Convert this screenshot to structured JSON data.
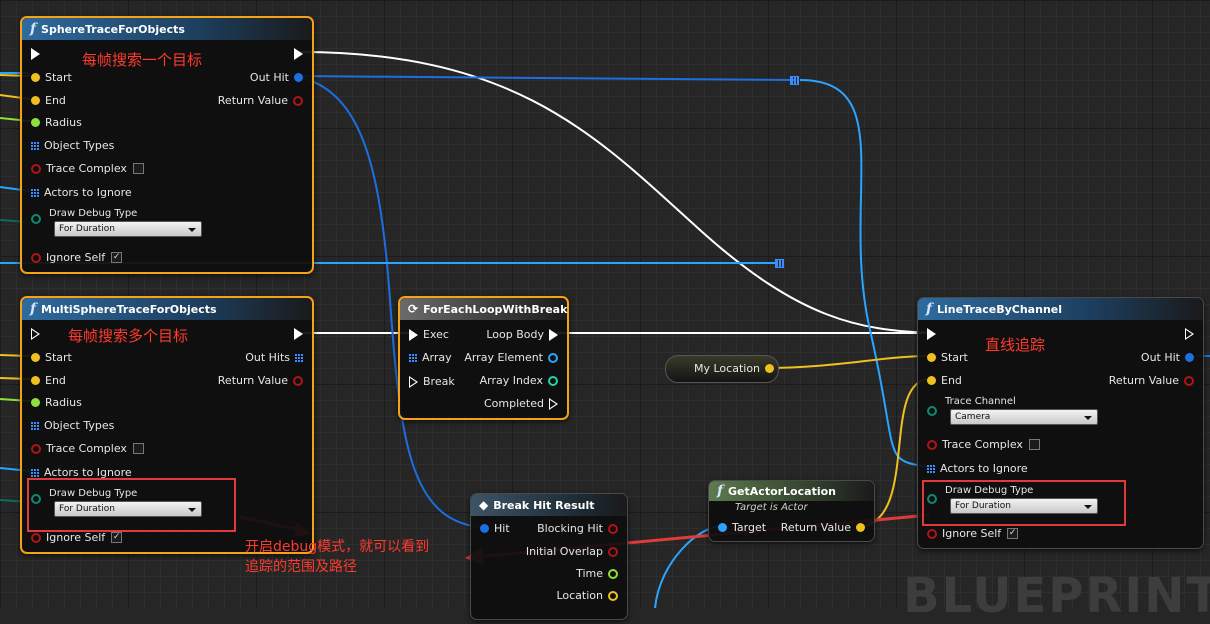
{
  "watermark": "BLUEPRINT",
  "colors": {
    "vector": "#f0c020",
    "float": "#8ce23a",
    "struct": "#1c6fe0",
    "bool": "#9a1010",
    "object": "#2aa4ff",
    "enum": "#0e6b58",
    "int": "#1ed6a3",
    "exec": "#ffffff",
    "selection": "#f5a217",
    "annotation": "#ff3a2e"
  },
  "nodes": {
    "sphere": {
      "title": "SphereTraceForObjects",
      "pins_in": {
        "start": "Start",
        "end": "End",
        "radius": "Radius",
        "object_types": "Object Types",
        "trace_complex": "Trace Complex",
        "actors_to_ignore": "Actors to Ignore",
        "draw_debug_type": "Draw Debug Type",
        "ignore_self": "Ignore Self"
      },
      "pins_out": {
        "out_hit": "Out Hit",
        "return_value": "Return Value"
      },
      "draw_debug_value": "For Duration"
    },
    "multisphere": {
      "title": "MultiSphereTraceForObjects",
      "pins_in": {
        "start": "Start",
        "end": "End",
        "radius": "Radius",
        "object_types": "Object Types",
        "trace_complex": "Trace Complex",
        "actors_to_ignore": "Actors to Ignore",
        "draw_debug_type": "Draw Debug Type",
        "ignore_self": "Ignore Self"
      },
      "pins_out": {
        "out_hits": "Out Hits",
        "return_value": "Return Value"
      },
      "draw_debug_value": "For Duration"
    },
    "foreach": {
      "title": "ForEachLoopWithBreak",
      "pins_in": {
        "exec": "Exec",
        "array": "Array",
        "break": "Break"
      },
      "pins_out": {
        "loop_body": "Loop Body",
        "array_element": "Array Element",
        "array_index": "Array Index",
        "completed": "Completed"
      }
    },
    "mylocation": {
      "label": "My Location"
    },
    "linetrace": {
      "title": "LineTraceByChannel",
      "pins_in": {
        "start": "Start",
        "end": "End",
        "trace_channel": "Trace Channel",
        "trace_complex": "Trace Complex",
        "actors_to_ignore": "Actors to Ignore",
        "draw_debug_type": "Draw Debug Type",
        "ignore_self": "Ignore Self"
      },
      "pins_out": {
        "out_hit": "Out Hit",
        "return_value": "Return Value"
      },
      "trace_channel_value": "Camera",
      "draw_debug_value": "For Duration"
    },
    "getactorlocation": {
      "title": "GetActorLocation",
      "subtitle": "Target is Actor",
      "pin_in": "Target",
      "pin_out": "Return Value"
    },
    "breakhit": {
      "title": "Break Hit Result",
      "pin_in": "Hit",
      "pins_out": {
        "blocking_hit": "Blocking Hit",
        "initial_overlap": "Initial Overlap",
        "time": "Time",
        "location": "Location"
      }
    }
  },
  "annotations": {
    "per_frame_one": "每帧搜索一个目标",
    "per_frame_many": "每帧搜索多个目标",
    "line_trace": "直线追踪",
    "debug_line1": "开启debug模式，就可以看到",
    "debug_line2": "追踪的范围及路径"
  }
}
